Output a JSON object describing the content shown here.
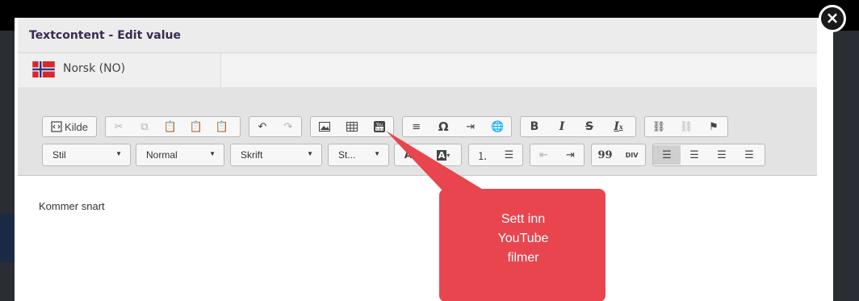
{
  "modal": {
    "title": "Textcontent - Edit value",
    "close_label": "×"
  },
  "language": {
    "label": "Norsk (NO)",
    "flag": "norway-flag"
  },
  "toolbar": {
    "source_label": "Kilde",
    "style_label": "Stil",
    "format_label": "Normal",
    "font_label": "Skrift",
    "size_label": "St...",
    "bold": "B",
    "italic": "I",
    "strike": "S",
    "removeformat": "I",
    "omega": "Ω",
    "quote": "99",
    "div": "DIV"
  },
  "editor": {
    "text": "Kommer snart"
  },
  "callout": {
    "lines": [
      "Sett inn",
      "YouTube",
      "filmer"
    ],
    "color": "#e8454f"
  },
  "colors": {
    "title": "#3a2a52",
    "toolbar_bg": "#e3e3e3",
    "callout": "#e8454f"
  }
}
